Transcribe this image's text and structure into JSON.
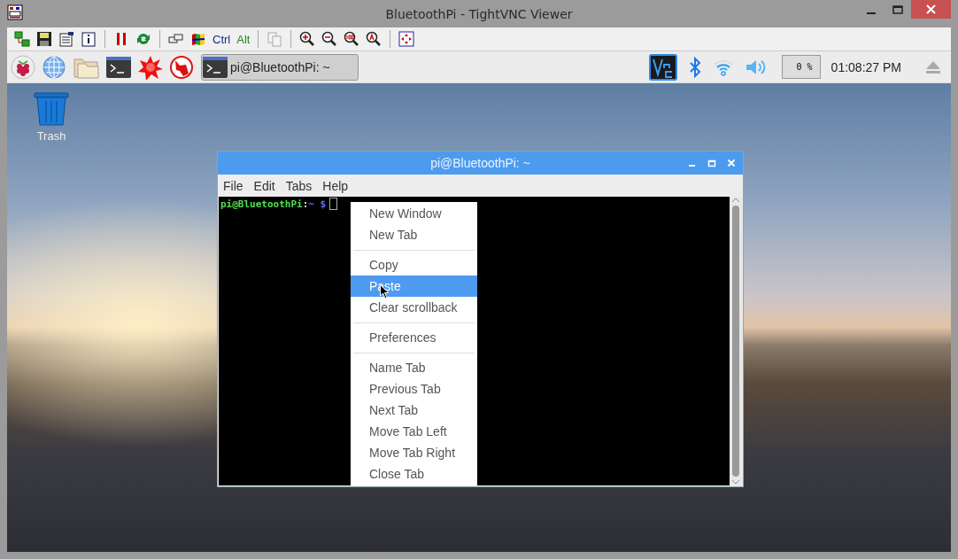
{
  "window": {
    "title": "BluetoothPi - TightVNC Viewer"
  },
  "toolbar": {
    "ctrl_label": "Ctrl",
    "alt_label": "Alt"
  },
  "taskbar": {
    "task_button": {
      "label": "pi@BluetoothPi: ~",
      "selected": true
    },
    "cpu_reading": "0 %",
    "clock": "01:08:27 PM"
  },
  "desktop_icons": [
    {
      "label": "Trash"
    }
  ],
  "terminal": {
    "title": "pi@BluetoothPi: ~",
    "menu": [
      "File",
      "Edit",
      "Tabs",
      "Help"
    ],
    "prompt": [
      {
        "kind": "user",
        "text": "pi@BluetoothPi"
      },
      {
        "kind": "separator",
        "text": ":"
      },
      {
        "kind": "path",
        "text": "~ $"
      }
    ]
  },
  "context_menu": {
    "items": [
      {
        "kind": "item",
        "label": "New Window",
        "selected": false
      },
      {
        "kind": "item",
        "label": "New Tab",
        "selected": false
      },
      {
        "kind": "separator"
      },
      {
        "kind": "item",
        "label": "Copy",
        "selected": false
      },
      {
        "kind": "item",
        "label": "Paste",
        "selected": true
      },
      {
        "kind": "item",
        "label": "Clear scrollback",
        "selected": false
      },
      {
        "kind": "separator"
      },
      {
        "kind": "item",
        "label": "Preferences",
        "selected": false
      },
      {
        "kind": "separator"
      },
      {
        "kind": "item",
        "label": "Name Tab",
        "selected": false
      },
      {
        "kind": "item",
        "label": "Previous Tab",
        "selected": false
      },
      {
        "kind": "item",
        "label": "Next Tab",
        "selected": false
      },
      {
        "kind": "item",
        "label": "Move Tab Left",
        "selected": false
      },
      {
        "kind": "item",
        "label": "Move Tab Right",
        "selected": false
      },
      {
        "kind": "item",
        "label": "Close Tab",
        "selected": false
      }
    ]
  }
}
